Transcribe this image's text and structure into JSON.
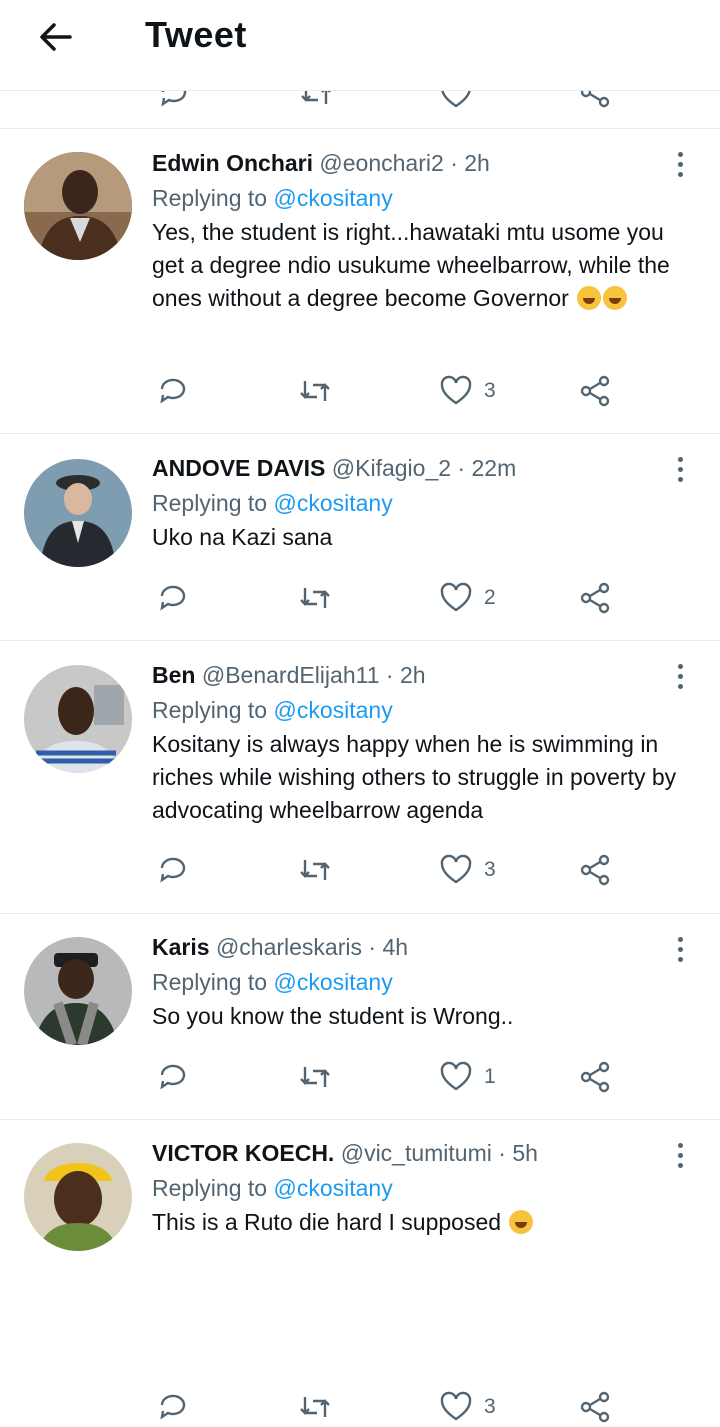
{
  "header": {
    "title": "Tweet",
    "back_icon": "arrow-left-icon"
  },
  "colors": {
    "link": "#1d9bf0",
    "muted": "#536471",
    "text": "#0f1419",
    "divider": "#e6ecf0"
  },
  "replies": [
    {
      "name": "Edwin Onchari",
      "handle": "@eonchari2",
      "time": "2h",
      "replying_prefix": "Replying to",
      "replying_to": "@ckositany",
      "text": "Yes, the student is right...hawataki mtu usome you get a degree ndio usukume wheelbarrow, while the ones without a degree become Governor",
      "emoji_count": 2,
      "likes": "3"
    },
    {
      "name": "ANDOVE DAVIS",
      "handle": "@Kifagio_2",
      "time": "22m",
      "replying_prefix": "Replying to",
      "replying_to": "@ckositany",
      "text": "Uko na Kazi sana",
      "emoji_count": 0,
      "likes": "2"
    },
    {
      "name": "Ben",
      "handle": "@BenardElijah11",
      "time": "2h",
      "replying_prefix": "Replying to",
      "replying_to": "@ckositany",
      "text": "Kositany is always happy when he is swimming in riches while wishing others to struggle in poverty by advocating wheelbarrow agenda",
      "emoji_count": 0,
      "likes": "3"
    },
    {
      "name": "Karis",
      "handle": "@charleskaris",
      "time": "4h",
      "replying_prefix": "Replying to",
      "replying_to": "@ckositany",
      "text": "So you know the student is Wrong..",
      "emoji_count": 0,
      "likes": "1"
    },
    {
      "name": "VICTOR KOECH.",
      "handle": "@vic_tumitumi",
      "time": "5h",
      "replying_prefix": "Replying to",
      "replying_to": "@ckositany",
      "text": "This is a Ruto die hard I supposed",
      "emoji_count": 1,
      "likes": "3"
    }
  ]
}
